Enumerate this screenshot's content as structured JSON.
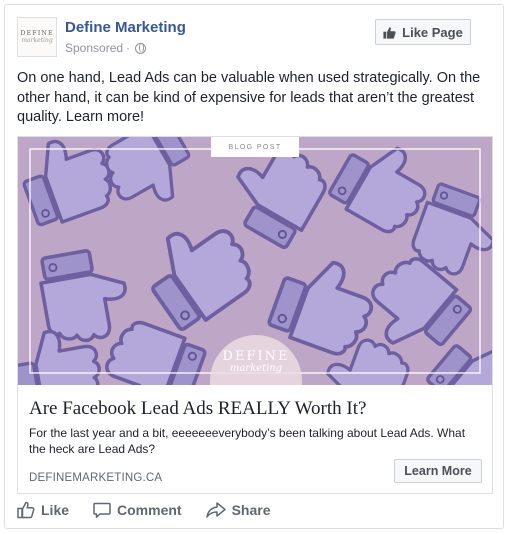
{
  "post": {
    "page_name": "Define Marketing",
    "sponsored_label": "Sponsored",
    "sponsored_separator": "·",
    "like_page_label": "Like Page",
    "text": "On one hand, Lead Ads can be valuable when used strategically. On the other hand, it can be kind of expensive for leads that aren’t the greatest quality. Learn more!",
    "avatar": {
      "line1": "DEFINE",
      "line2": "marketing"
    }
  },
  "attachment": {
    "badge": "BLOG POST",
    "hero_logo": {
      "line1": "DEFINE",
      "line2": "marketing"
    },
    "title": "Are Facebook Lead Ads REALLY Worth It?",
    "description": "For the last year and a bit, eeeeeeeverybody’s been talking about Lead Ads. What the heck are Lead Ads?",
    "domain": "DEFINEMARKETING.CA",
    "cta_label": "Learn More"
  },
  "actions": {
    "like_label": "Like",
    "comment_label": "Comment",
    "share_label": "Share"
  },
  "colors": {
    "page_name": "#365899",
    "secondary_text": "#90949c",
    "hero_background": "#b9a3c4",
    "thumb_fill": "#a79bd0",
    "thumb_stroke": "#6a5c9e",
    "card_border": "#dddfe2"
  },
  "icons": {
    "like_page_button": "thumbs-up-icon",
    "audience": "globe-icon",
    "like_action": "thumbs-up-outline-icon",
    "comment_action": "speech-bubble-icon",
    "share_action": "share-arrow-icon"
  }
}
